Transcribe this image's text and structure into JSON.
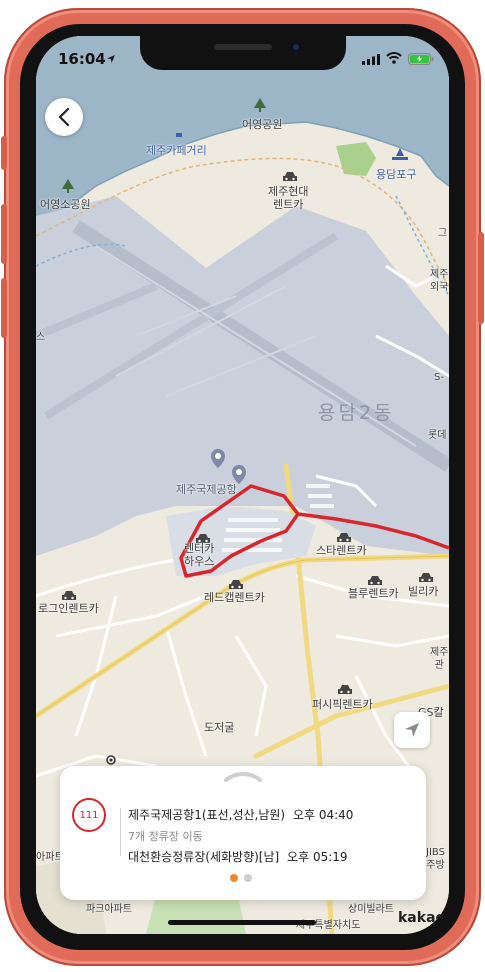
{
  "status_bar": {
    "time": "16:04"
  },
  "colors": {
    "route": "#d9262c",
    "water": "#9cb6c8",
    "airport": "#c9d0dc",
    "land": "#eeeadf",
    "road_major": "#f1d982",
    "road_minor": "#ffffff",
    "active_dot": "#f0892e"
  },
  "icons": {
    "back": "chevron-left-icon",
    "my_location": "navigation-arrow-icon",
    "car": "car-icon",
    "tree": "tree-icon",
    "plane_pin": "airport-pin-icon",
    "handle": "chevron-up-icon"
  },
  "map": {
    "labels": {
      "eoyeong_park": "어영공원",
      "jeju_cafe_street": "제주카페거리",
      "yongdampogu": "용담포구",
      "jeju_hyundai_rentcar": "제주현대\n렌트카",
      "eoyeongso_park": "어영소공원",
      "yongdam2dong": "용담2동",
      "jeju_airport": "제주국제공항",
      "rentcar_house": "렌터카\n하우스",
      "star_rentcar": "스타렌트카",
      "blue_rentcar": "블루렌트카",
      "billika": "빌리카",
      "log_in_rentcar": "로그인렌트카",
      "redcap_rentcar": "레드캡렌트카",
      "pacific_rentcar": "퍼시픽렌트카",
      "dojeogul": "도저굴",
      "gs_cal": "GS칼",
      "right_edge_1": "제주\n외국",
      "right_edge_2": "S-",
      "right_edge_3": "롯데",
      "right_edge_4": "제주\n관",
      "right_edge_5": "그",
      "left_edge_1": "스",
      "jibs": "JIBS\n주방",
      "apartment": "아파트",
      "sangmi": "상미빌라트",
      "pine": "파크아파트",
      "jeju_special": "제주특별자치도"
    },
    "watermark": "kakao"
  },
  "bus_sheet": {
    "route_number": "111",
    "departure_stop": "제주국제공항1(표선,성산,남원)",
    "departure_time": "오후 04:40",
    "transfer_info": "7개 정류장 이동",
    "arrival_stop": "대천환승정류장(세화방향)[남]",
    "arrival_time": "오후 05:19",
    "page_count": 2,
    "active_page": 1
  }
}
